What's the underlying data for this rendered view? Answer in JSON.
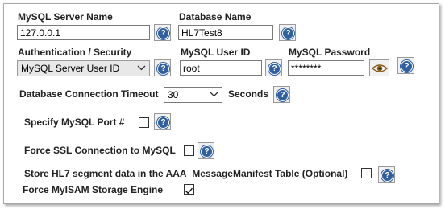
{
  "server": {
    "label": "MySQL Server Name",
    "value": "127.0.0.1"
  },
  "database": {
    "label": "Database Name",
    "value": "HL7Test8"
  },
  "auth": {
    "label": "Authentication / Security",
    "value": "MySQL Server User ID"
  },
  "user": {
    "label": "MySQL User ID",
    "value": "root"
  },
  "password": {
    "label": "MySQL Password",
    "value": "********"
  },
  "timeout": {
    "label": "Database Connection Timeout",
    "value": "30",
    "unit": "Seconds"
  },
  "port": {
    "label": "Specify MySQL Port #",
    "checked": false
  },
  "ssl": {
    "label": "Force SSL Connection to MySQL",
    "checked": false
  },
  "manifest": {
    "label": "Store HL7 segment data in the AAA_MessageManifest Table (Optional)",
    "checked": false
  },
  "myisam": {
    "label": "Force MyISAM Storage Engine",
    "checked": true
  },
  "help_glyph": "?",
  "colors": {
    "help_icon": "#2f5f9e",
    "eye_icon": "#8a5a1a"
  }
}
